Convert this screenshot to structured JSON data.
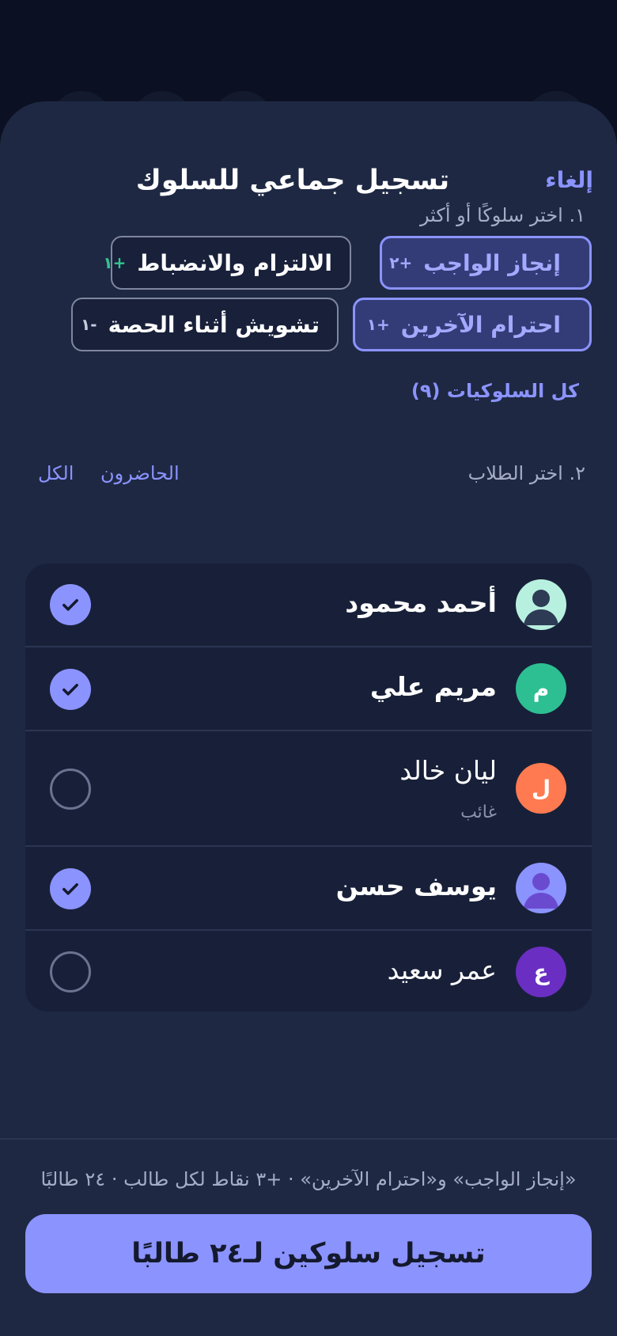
{
  "header": {
    "title": "تسجيل جماعي للسلوك",
    "cancel_label": "إلغاء"
  },
  "behaviors": {
    "label": "١. اختر سلوكًا أو أكثر",
    "chips": [
      {
        "label": "إنجاز الواجب",
        "points": "+٢",
        "selected": true
      },
      {
        "label": "الالتزام والانضباط",
        "points": "+١",
        "selected": false
      },
      {
        "label": "احترام الآخرين",
        "points": "+١",
        "selected": true
      },
      {
        "label": "تشويش أثناء الحصة",
        "points": "-١",
        "selected": false
      }
    ],
    "all_link": "كل السلوكيات (٩)"
  },
  "students": {
    "label": "٢. اختر الطلاب",
    "present_link": "الحاضرون",
    "all_link": "الكل",
    "items": [
      {
        "name": "أحمد محمود",
        "avatar": "person-icon",
        "avatar_color": "#b8f0df",
        "selected": true
      },
      {
        "name": "مريم علي",
        "avatar_letter": "م",
        "avatar_color": "#2dbf92",
        "selected": true
      },
      {
        "name": "ليان خالد",
        "avatar_letter": "ل",
        "avatar_color": "#ff7a50",
        "status": "غائب",
        "selected": false
      },
      {
        "name": "يوسف حسن",
        "avatar": "person-icon",
        "avatar_color": "#8b93ff",
        "selected": true
      },
      {
        "name": "عمر سعيد",
        "avatar_letter": "ع",
        "avatar_color": "#6a2ec2",
        "selected": false
      }
    ]
  },
  "footer": {
    "summary": "«إنجاز الواجب» و«احترام الآخرين» · +٣ نقاط لكل طالب · ٢٤ طالبًا",
    "submit_label": "تسجيل سلوكين لـ٢٤ طالبًا"
  },
  "colors": {
    "accent": "#8b93ff",
    "sheet_bg": "#1e2843",
    "positive": "#35c48f"
  }
}
